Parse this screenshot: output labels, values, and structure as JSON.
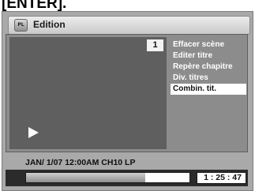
{
  "header_instruction": "[ENTER].",
  "window": {
    "icon_label": "PL",
    "title": "Edition"
  },
  "preview": {
    "scene_number": "1",
    "play_icon": "play-icon"
  },
  "menu": {
    "items": [
      {
        "label": "Effacer scène"
      },
      {
        "label": "Editer titre"
      },
      {
        "label": "Repère chapitre"
      },
      {
        "label": "Div. titres"
      },
      {
        "label": "Combin. tit."
      }
    ],
    "selected_index": 4
  },
  "info": {
    "recording_info": "JAN/ 1/07 12:00AM CH10   LP"
  },
  "playback": {
    "progress_percent": 73,
    "time": "1 : 25 : 47"
  }
}
